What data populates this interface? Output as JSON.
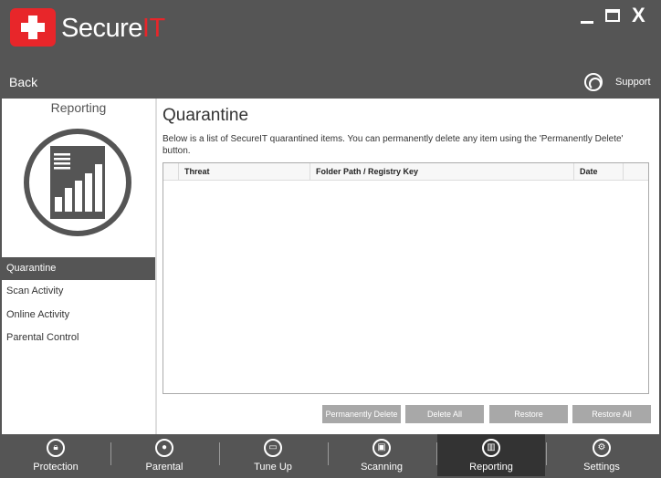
{
  "app": {
    "brand_primary": "Secure",
    "brand_accent": "IT",
    "accent_color": "#e8262a",
    "window_controls": {
      "close_label": "X"
    }
  },
  "header": {
    "back_label": "Back",
    "support_label": "Support"
  },
  "sidebar": {
    "title": "Reporting",
    "icon": "report-chart-icon",
    "items": [
      {
        "label": "Quarantine",
        "active": true
      },
      {
        "label": "Scan Activity",
        "active": false
      },
      {
        "label": "Online Activity",
        "active": false
      },
      {
        "label": "Parental Control",
        "active": false
      }
    ]
  },
  "main": {
    "title": "Quarantine",
    "description": "Below is a list of SecureIT quarantined items. You can permanently delete any item using the 'Permanently Delete' button.",
    "table": {
      "columns": [
        "",
        "Threat",
        "Folder Path / Registry Key",
        "Date",
        ""
      ],
      "rows": []
    },
    "buttons": {
      "permanently_delete": "Permanently Delete",
      "delete_all": "Delete All",
      "restore": "Restore",
      "restore_all": "Restore All"
    }
  },
  "bottom_nav": {
    "items": [
      {
        "label": "Protection",
        "icon": "lock-icon",
        "active": false
      },
      {
        "label": "Parental",
        "icon": "parental-icon",
        "active": false
      },
      {
        "label": "Tune Up",
        "icon": "tuneup-icon",
        "active": false
      },
      {
        "label": "Scanning",
        "icon": "scanning-icon",
        "active": false
      },
      {
        "label": "Reporting",
        "icon": "reporting-icon",
        "active": true
      },
      {
        "label": "Settings",
        "icon": "gear-icon",
        "active": false
      }
    ]
  }
}
